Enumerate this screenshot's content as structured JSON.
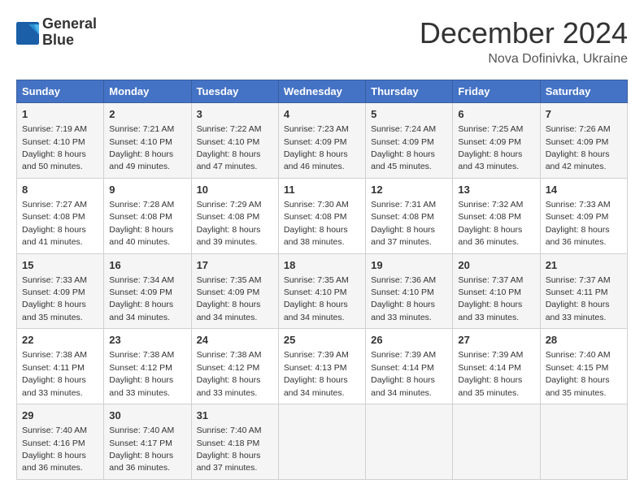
{
  "header": {
    "logo_line1": "General",
    "logo_line2": "Blue",
    "month_year": "December 2024",
    "location": "Nova Dofinivka, Ukraine"
  },
  "weekdays": [
    "Sunday",
    "Monday",
    "Tuesday",
    "Wednesday",
    "Thursday",
    "Friday",
    "Saturday"
  ],
  "weeks": [
    [
      {
        "day": "1",
        "sunrise": "7:19 AM",
        "sunset": "4:10 PM",
        "daylight": "8 hours and 50 minutes."
      },
      {
        "day": "2",
        "sunrise": "7:21 AM",
        "sunset": "4:10 PM",
        "daylight": "8 hours and 49 minutes."
      },
      {
        "day": "3",
        "sunrise": "7:22 AM",
        "sunset": "4:10 PM",
        "daylight": "8 hours and 47 minutes."
      },
      {
        "day": "4",
        "sunrise": "7:23 AM",
        "sunset": "4:09 PM",
        "daylight": "8 hours and 46 minutes."
      },
      {
        "day": "5",
        "sunrise": "7:24 AM",
        "sunset": "4:09 PM",
        "daylight": "8 hours and 45 minutes."
      },
      {
        "day": "6",
        "sunrise": "7:25 AM",
        "sunset": "4:09 PM",
        "daylight": "8 hours and 43 minutes."
      },
      {
        "day": "7",
        "sunrise": "7:26 AM",
        "sunset": "4:09 PM",
        "daylight": "8 hours and 42 minutes."
      }
    ],
    [
      {
        "day": "8",
        "sunrise": "7:27 AM",
        "sunset": "4:08 PM",
        "daylight": "8 hours and 41 minutes."
      },
      {
        "day": "9",
        "sunrise": "7:28 AM",
        "sunset": "4:08 PM",
        "daylight": "8 hours and 40 minutes."
      },
      {
        "day": "10",
        "sunrise": "7:29 AM",
        "sunset": "4:08 PM",
        "daylight": "8 hours and 39 minutes."
      },
      {
        "day": "11",
        "sunrise": "7:30 AM",
        "sunset": "4:08 PM",
        "daylight": "8 hours and 38 minutes."
      },
      {
        "day": "12",
        "sunrise": "7:31 AM",
        "sunset": "4:08 PM",
        "daylight": "8 hours and 37 minutes."
      },
      {
        "day": "13",
        "sunrise": "7:32 AM",
        "sunset": "4:08 PM",
        "daylight": "8 hours and 36 minutes."
      },
      {
        "day": "14",
        "sunrise": "7:33 AM",
        "sunset": "4:09 PM",
        "daylight": "8 hours and 36 minutes."
      }
    ],
    [
      {
        "day": "15",
        "sunrise": "7:33 AM",
        "sunset": "4:09 PM",
        "daylight": "8 hours and 35 minutes."
      },
      {
        "day": "16",
        "sunrise": "7:34 AM",
        "sunset": "4:09 PM",
        "daylight": "8 hours and 34 minutes."
      },
      {
        "day": "17",
        "sunrise": "7:35 AM",
        "sunset": "4:09 PM",
        "daylight": "8 hours and 34 minutes."
      },
      {
        "day": "18",
        "sunrise": "7:35 AM",
        "sunset": "4:10 PM",
        "daylight": "8 hours and 34 minutes."
      },
      {
        "day": "19",
        "sunrise": "7:36 AM",
        "sunset": "4:10 PM",
        "daylight": "8 hours and 33 minutes."
      },
      {
        "day": "20",
        "sunrise": "7:37 AM",
        "sunset": "4:10 PM",
        "daylight": "8 hours and 33 minutes."
      },
      {
        "day": "21",
        "sunrise": "7:37 AM",
        "sunset": "4:11 PM",
        "daylight": "8 hours and 33 minutes."
      }
    ],
    [
      {
        "day": "22",
        "sunrise": "7:38 AM",
        "sunset": "4:11 PM",
        "daylight": "8 hours and 33 minutes."
      },
      {
        "day": "23",
        "sunrise": "7:38 AM",
        "sunset": "4:12 PM",
        "daylight": "8 hours and 33 minutes."
      },
      {
        "day": "24",
        "sunrise": "7:38 AM",
        "sunset": "4:12 PM",
        "daylight": "8 hours and 33 minutes."
      },
      {
        "day": "25",
        "sunrise": "7:39 AM",
        "sunset": "4:13 PM",
        "daylight": "8 hours and 34 minutes."
      },
      {
        "day": "26",
        "sunrise": "7:39 AM",
        "sunset": "4:14 PM",
        "daylight": "8 hours and 34 minutes."
      },
      {
        "day": "27",
        "sunrise": "7:39 AM",
        "sunset": "4:14 PM",
        "daylight": "8 hours and 35 minutes."
      },
      {
        "day": "28",
        "sunrise": "7:40 AM",
        "sunset": "4:15 PM",
        "daylight": "8 hours and 35 minutes."
      }
    ],
    [
      {
        "day": "29",
        "sunrise": "7:40 AM",
        "sunset": "4:16 PM",
        "daylight": "8 hours and 36 minutes."
      },
      {
        "day": "30",
        "sunrise": "7:40 AM",
        "sunset": "4:17 PM",
        "daylight": "8 hours and 36 minutes."
      },
      {
        "day": "31",
        "sunrise": "7:40 AM",
        "sunset": "4:18 PM",
        "daylight": "8 hours and 37 minutes."
      },
      null,
      null,
      null,
      null
    ]
  ]
}
